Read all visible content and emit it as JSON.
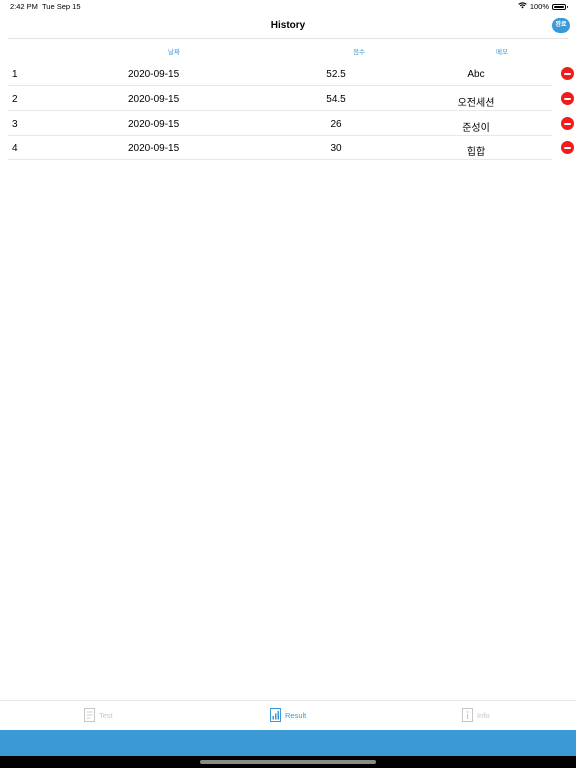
{
  "status": {
    "time": "2:42 PM",
    "date": "Tue Sep 15",
    "battery": "100%",
    "icons": [
      "wifi-icon",
      "battery-icon"
    ]
  },
  "nav": {
    "title": "History",
    "done_label": "완료"
  },
  "table": {
    "headers": {
      "date": "날짜",
      "score": "점수",
      "memo": "메모"
    },
    "rows": [
      {
        "index": "1",
        "date": "2020-09-15",
        "score": "52.5",
        "memo": "Abc"
      },
      {
        "index": "2",
        "date": "2020-09-15",
        "score": "54.5",
        "memo": "오전세션"
      },
      {
        "index": "3",
        "date": "2020-09-15",
        "score": "26",
        "memo": "준성이"
      },
      {
        "index": "4",
        "date": "2020-09-15",
        "score": "30",
        "memo": "힙합"
      }
    ]
  },
  "tabs": [
    {
      "label": "Test",
      "icon": "document-icon",
      "selected": false
    },
    {
      "label": "Result",
      "icon": "chart-document-icon",
      "selected": true
    },
    {
      "label": "Info",
      "icon": "info-document-icon",
      "selected": false
    }
  ],
  "colors": {
    "accent": "#3b9ad6",
    "delete": "#ee1c1c",
    "inactive_tab": "#c7c7c7"
  }
}
